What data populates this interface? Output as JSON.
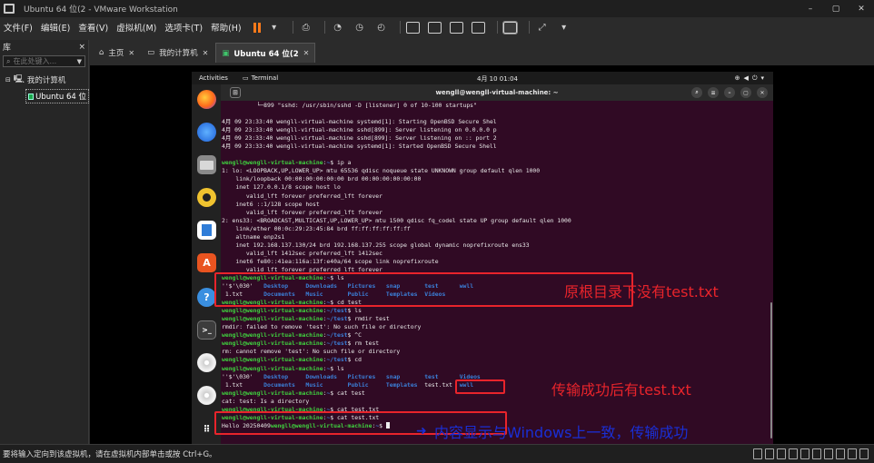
{
  "window": {
    "title": "Ubuntu 64 位(2 - VMware Workstation",
    "minimize_glyph": "–",
    "maximize_glyph": "▢",
    "close_glyph": "✕"
  },
  "menu": {
    "items": [
      "文件(F)",
      "编辑(E)",
      "查看(V)",
      "虚拟机(M)",
      "选项卡(T)",
      "帮助(H)"
    ]
  },
  "library": {
    "title": "库",
    "close_glyph": "×",
    "search_placeholder": "在此处键入...",
    "tree_root": "我的计算机",
    "tree_vm": "Ubuntu 64 位"
  },
  "tabs": [
    {
      "label": "主页"
    },
    {
      "label": "我的计算机"
    },
    {
      "label": "Ubuntu 64 位(2"
    }
  ],
  "ubuntu": {
    "activities": "Activities",
    "app_name": "Terminal",
    "clock": "4月 10  01:04",
    "window_title": "wengll@wengll-virtual-machine: ~"
  },
  "terminal": {
    "lines": [
      {
        "text": "          └─899 \"sshd: /usr/sbin/sshd -D [listener] 0 of 10-100 startups\""
      },
      {
        "text": ""
      },
      {
        "text": "4月 09 23:33:40 wengll-virtual-machine systemd[1]: Starting OpenBSD Secure Shel"
      },
      {
        "text": "4月 09 23:33:40 wengll-virtual-machine sshd[899]: Server listening on 0.0.0.0 p"
      },
      {
        "text": "4月 09 23:33:40 wengll-virtual-machine sshd[899]: Server listening on :: port 2"
      },
      {
        "text": "4月 09 23:33:40 wengll-virtual-machine systemd[1]: Started OpenBSD Secure Shell"
      },
      {
        "text": ""
      },
      {
        "text": "wengll@wengll-virtual-machine:~$ ip a"
      },
      {
        "text": "1: lo: <LOOPBACK,UP,LOWER_UP> mtu 65536 qdisc noqueue state UNKNOWN group default qlen 1000"
      },
      {
        "text": "    link/loopback 00:00:00:00:00:00 brd 00:00:00:00:00:00"
      },
      {
        "text": "    inet 127.0.0.1/8 scope host lo"
      },
      {
        "text": "       valid_lft forever preferred_lft forever"
      },
      {
        "text": "    inet6 ::1/128 scope host"
      },
      {
        "text": "       valid_lft forever preferred_lft forever"
      },
      {
        "text": "2: ens33: <BROADCAST,MULTICAST,UP,LOWER_UP> mtu 1500 qdisc fq_codel state UP group default qlen 1000"
      },
      {
        "text": "    link/ether 00:0c:29:23:45:84 brd ff:ff:ff:ff:ff:ff"
      },
      {
        "text": "    altname enp2s1"
      },
      {
        "text": "    inet 192.168.137.130/24 brd 192.168.137.255 scope global dynamic noprefixroute ens33"
      },
      {
        "text": "       valid_lft 1412sec preferred_lft 1412sec"
      },
      {
        "text": "    inet6 fe80::41ea:116a:13f:e40a/64 scope link noprefixroute"
      },
      {
        "text": "       valid_lft forever preferred_lft forever"
      },
      {
        "text": "wengll@wengll-virtual-machine:~$ ls"
      },
      {
        "text": "''$'\\030'   Desktop     Downloads   Pictures   snap       test      wwll"
      },
      {
        "text": " 1.txt      Documents   Music       Public     Templates  Videos"
      },
      {
        "text": "wengll@wengll-virtual-machine:~$ cd test"
      },
      {
        "text": "wengll@wengll-virtual-machine:~/test$ ls"
      },
      {
        "text": "wengll@wengll-virtual-machine:~/test$ rmdir test"
      },
      {
        "text": "rmdir: failed to remove 'test': No such file or directory"
      },
      {
        "text": "wengll@wengll-virtual-machine:~/test$ ^C"
      },
      {
        "text": "wengll@wengll-virtual-machine:~/test$ rm test"
      },
      {
        "text": "rm: cannot remove 'test': No such file or directory"
      },
      {
        "text": "wengll@wengll-virtual-machine:~/test$ cd"
      },
      {
        "text": "wengll@wengll-virtual-machine:~$ ls"
      },
      {
        "text": "''$'\\030'   Desktop     Downloads   Pictures   snap       test      Videos"
      },
      {
        "text": " 1.txt      Documents   Music       Public     Templates  test.txt  wwll"
      },
      {
        "text": "wengll@wengll-virtual-machine:~$ cat test"
      },
      {
        "text": "cat: test: Is a directory"
      },
      {
        "text": "wengll@wengll-virtual-machine:~$ cat test.txt"
      },
      {
        "text": "wengll@wengll-virtual-machine:~$ cat test.txt"
      },
      {
        "text": "Hello 20250409wengll@wengll-virtual-machine:~$ "
      }
    ]
  },
  "annotations": {
    "a1": "原根目录下没有test.txt",
    "a2": "传输成功后有test.txt",
    "a3": "内容显示与Windows上一致，传输成功"
  },
  "colors": {
    "annotation_red": "#e8242b",
    "annotation_blue": "#1a2fd6",
    "terminal_bg": "#300a24",
    "prompt_green": "#3fd23f",
    "path_blue": "#3b7fd8",
    "dir_blue": "#3b7fd8"
  },
  "status": {
    "text": "要将输入定向到该虚拟机，请在虚拟机内部单击或按 Ctrl+G。"
  }
}
